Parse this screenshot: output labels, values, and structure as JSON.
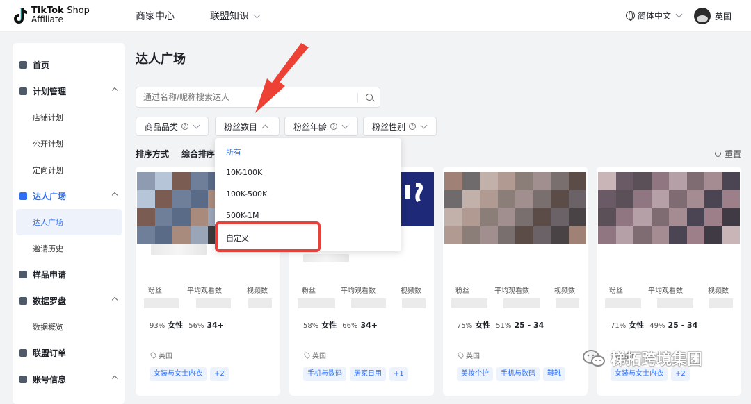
{
  "header": {
    "logo_brand": "TikTok",
    "logo_shop": "Shop",
    "logo_sub": "Affiliate",
    "nav": [
      "商家中心",
      "联盟知识"
    ],
    "language": "简体中文",
    "region": "英国"
  },
  "sidebar": {
    "items": [
      {
        "label": "首页"
      },
      {
        "label": "计划管理"
      },
      {
        "label": "店铺计划"
      },
      {
        "label": "公开计划"
      },
      {
        "label": "定向计划"
      },
      {
        "label": "达人广场"
      },
      {
        "label": "达人广场"
      },
      {
        "label": "邀请历史"
      },
      {
        "label": "样品申请"
      },
      {
        "label": "数据罗盘"
      },
      {
        "label": "数据概览"
      },
      {
        "label": "联盟订单"
      },
      {
        "label": "账号信息"
      }
    ]
  },
  "main": {
    "title": "达人广场",
    "search_placeholder": "通过名称/昵称搜索达人",
    "filters": [
      "商品品类",
      "粉丝数目",
      "粉丝年龄",
      "粉丝性别"
    ],
    "sort_label": "排序方式",
    "sort_value": "综合排序",
    "reset": "重置"
  },
  "dropdown": {
    "options": [
      "所有",
      "10K-100K",
      "100K-500K",
      "500K-1M",
      "自定义"
    ],
    "selected": "所有"
  },
  "card_labels": {
    "followers": "粉丝",
    "avg_views": "平均观看数",
    "videos": "视频数"
  },
  "cards": [
    {
      "female_pct": "93%",
      "gender": "女性",
      "age_pct": "56%",
      "age": "34+",
      "location": "英国",
      "tags": [
        "女装与女士内衣",
        "+2"
      ]
    },
    {
      "female_pct": "58%",
      "gender": "女性",
      "age_pct": "66%",
      "age": "34+",
      "location": "英国",
      "tags": [
        "手机与数码",
        "居家日用",
        "+1"
      ]
    },
    {
      "female_pct": "75%",
      "gender": "女性",
      "age_pct": "51%",
      "age": "25 - 34",
      "location": "英国",
      "tags": [
        "美妆个护",
        "手机与数码",
        "鞋靴"
      ]
    },
    {
      "female_pct": "71%",
      "gender": "女性",
      "age_pct": "49%",
      "age": "25 - 34",
      "location": "英国",
      "tags": [
        "女装与女士内衣",
        "+2"
      ]
    }
  ],
  "watermark": "梯拓跨境集团",
  "colors": {
    "accent": "#2d6ff7",
    "highlight": "#e8403a"
  }
}
